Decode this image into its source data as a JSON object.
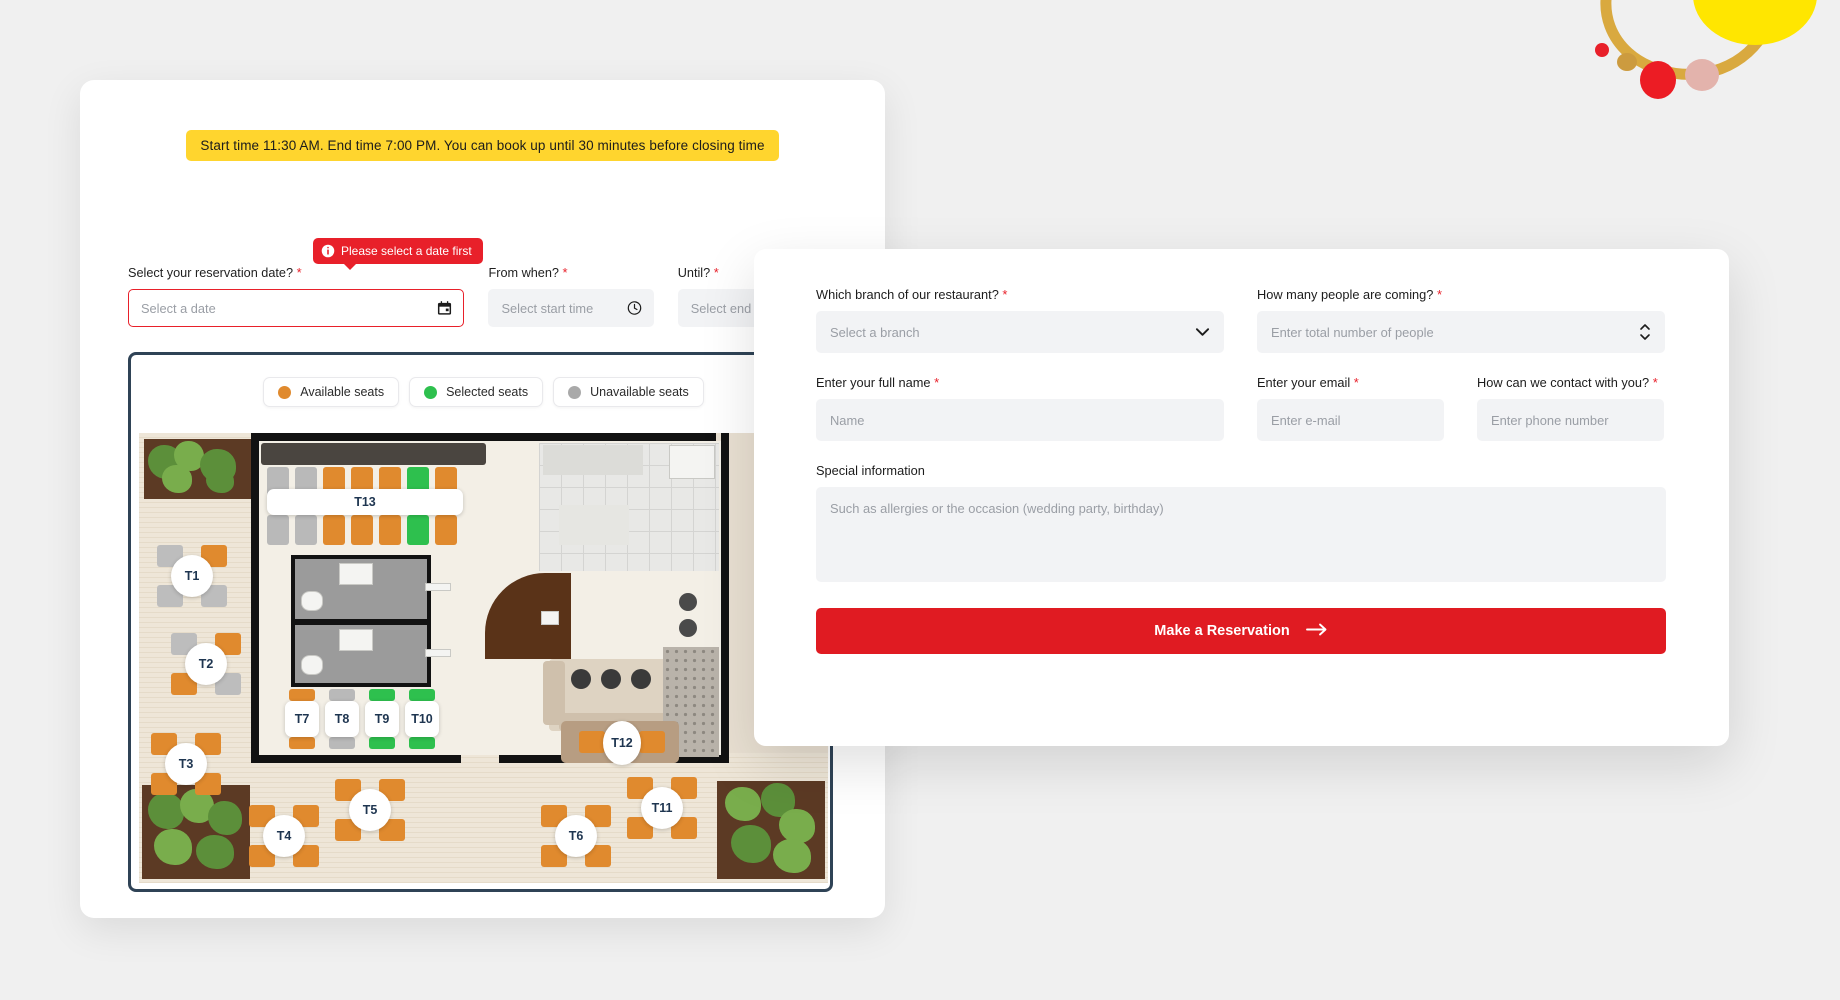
{
  "notice": {
    "text": "Start time 11:30 AM. End time 7:00 PM. You can book up until 30 minutes before closing time",
    "bg_color": "#ffd52e"
  },
  "date_time": {
    "date": {
      "label": "Select your reservation date?",
      "required_mark": "*",
      "placeholder": "Select a date",
      "value": "",
      "icon": "calendar-icon",
      "error_tooltip": "Please select a date first"
    },
    "start_time": {
      "label": "From when?",
      "required_mark": "*",
      "placeholder": "Select start time",
      "value": "",
      "icon": "clock-icon"
    },
    "end_time": {
      "label": "Until?",
      "required_mark": "*",
      "placeholder": "Select end time",
      "value": "",
      "icon": "clock-icon"
    }
  },
  "legend": [
    {
      "label": "Available seats",
      "color": "#e08a2e"
    },
    {
      "label": "Selected seats",
      "color": "#2ec04e"
    },
    {
      "label": "Unavailable seats",
      "color": "#a9a9a9"
    }
  ],
  "floor_plan": {
    "tables": [
      {
        "id": "T13",
        "shape": "pill"
      },
      {
        "id": "T1",
        "shape": "circle"
      },
      {
        "id": "T2",
        "shape": "circle"
      },
      {
        "id": "T3",
        "shape": "circle"
      },
      {
        "id": "T4",
        "shape": "circle"
      },
      {
        "id": "T5",
        "shape": "circle"
      },
      {
        "id": "T6",
        "shape": "circle"
      },
      {
        "id": "T7",
        "shape": "circle"
      },
      {
        "id": "T8",
        "shape": "pill"
      },
      {
        "id": "T9",
        "shape": "pill"
      },
      {
        "id": "T10",
        "shape": "pill"
      },
      {
        "id": "T11",
        "shape": "pill"
      },
      {
        "id": "T12",
        "shape": "circle"
      }
    ]
  },
  "form": {
    "branch": {
      "label": "Which branch of our restaurant?",
      "required_mark": "*",
      "placeholder": "Select a branch",
      "value": "",
      "icon": "chevron-down-icon"
    },
    "people": {
      "label": "How many people are coming?",
      "required_mark": "*",
      "placeholder": "Enter total number of people",
      "value": "",
      "icon": "stepper-icon"
    },
    "full_name": {
      "label": "Enter your full name",
      "required_mark": "*",
      "placeholder": "Name",
      "value": ""
    },
    "email": {
      "label": "Enter your email",
      "required_mark": "*",
      "placeholder": "Enter e-mail",
      "value": ""
    },
    "phone": {
      "label": "How can we contact with you?",
      "required_mark": "*",
      "placeholder": "Enter phone number",
      "value": ""
    },
    "special": {
      "label": "Special information",
      "placeholder": "Such as allergies or the occasion (wedding party, birthday)",
      "value": ""
    },
    "submit": {
      "label": "Make a Reservation",
      "icon": "arrow-right-icon",
      "color": "#e01b22"
    }
  }
}
